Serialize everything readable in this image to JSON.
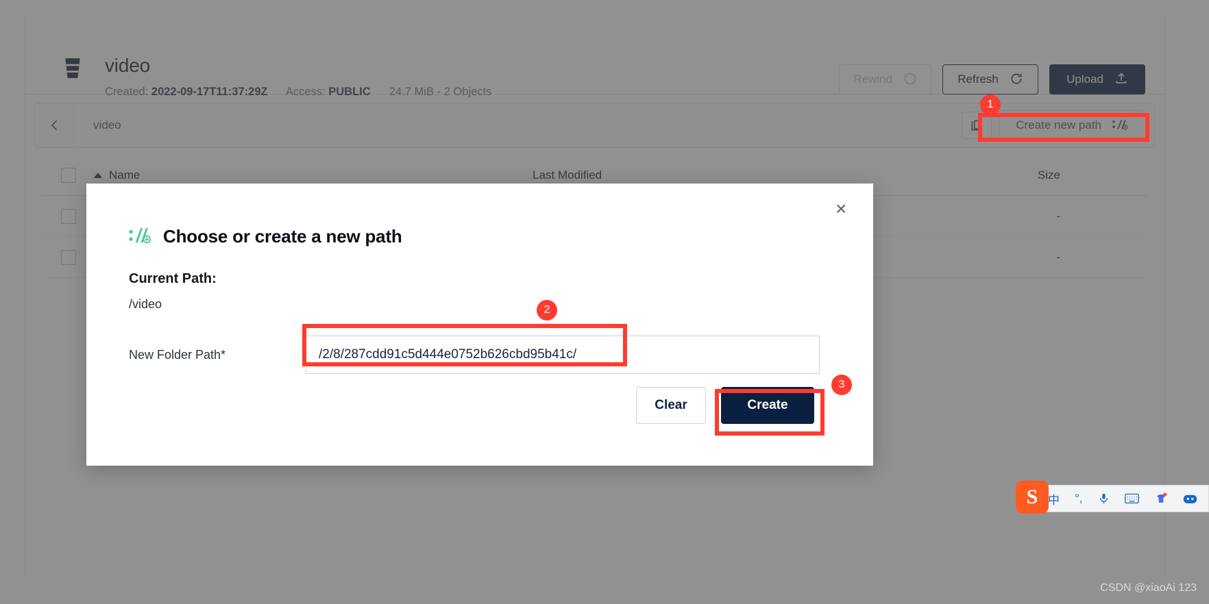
{
  "bucket": {
    "name": "video",
    "created_label": "Created:",
    "created_value": "2022-09-17T11:37:29Z",
    "access_label": "Access:",
    "access_value": "PUBLIC",
    "size_summary": "24.7 MiB - 2 Objects"
  },
  "header_actions": {
    "rewind_label": "Rewind",
    "refresh_label": "Refresh",
    "upload_label": "Upload"
  },
  "breadcrumb": {
    "path": "video",
    "create_new_path_label": "Create new path"
  },
  "table": {
    "columns": {
      "name": "Name",
      "last_modified": "Last Modified",
      "size": "Size"
    },
    "rows": [
      {
        "name": "",
        "last_modified": "",
        "size": "-"
      },
      {
        "name": "",
        "last_modified": "",
        "size": "-"
      }
    ]
  },
  "modal": {
    "title": "Choose or create a new path",
    "current_path_label": "Current Path:",
    "current_path_value": "/video",
    "field_label": "New Folder Path*",
    "field_value": "/2/8/287cdd91c5d444e0752b626cbd95b41c/",
    "field_placeholder": "",
    "clear_label": "Clear",
    "create_label": "Create",
    "close_glyph": "×"
  },
  "annotations": {
    "badge_1": "1",
    "badge_2": "2",
    "badge_3": "3",
    "color": "#ff3b30"
  },
  "ime": {
    "logo_text": "S",
    "items": [
      "中",
      "°,",
      "mic-icon",
      "keyboard-icon",
      "skin-icon",
      "emoji-icon",
      "more-icon"
    ]
  },
  "watermark": {
    "text": "CSDN @xiaoAi 123"
  },
  "colors": {
    "accent_dark": "#07193a",
    "brand_green": "#4ecb93",
    "annotation_red": "#ff3b30"
  }
}
